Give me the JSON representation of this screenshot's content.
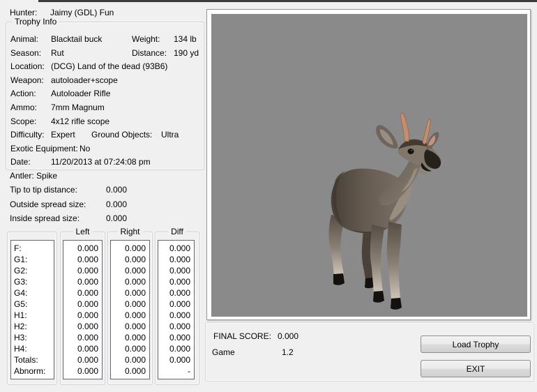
{
  "colors": {
    "window_bg": "#f0f0f0",
    "viewer_bg": "#8a8a8a",
    "top_edge": "#3b3b3b"
  },
  "hunter": {
    "label": "Hunter:",
    "value": "Jaimy (GDL) Fun"
  },
  "trophy_info": {
    "title": "Trophy Info",
    "rows": [
      {
        "label": "Animal:",
        "value": "Blacktail buck",
        "label2": "Weight:",
        "value2": "134 lb"
      },
      {
        "label": "Season:",
        "value": "Rut",
        "label2": "Distance:",
        "value2": "190 yd"
      },
      {
        "label": "Location:",
        "value": "(DCG) Land of the dead (93B6)"
      },
      {
        "label": "Weapon:",
        "value": "autoloader+scope"
      },
      {
        "label": "Action:",
        "value": "Autoloader Rifle"
      },
      {
        "label": "Ammo:",
        "value": "7mm Magnum"
      },
      {
        "label": "Scope:",
        "value": "4x12 rifle scope"
      },
      {
        "label": "Difficulty:",
        "value": "Expert",
        "label2": "Ground Objects:",
        "value2": "Ultra"
      },
      {
        "label": "Exotic Equipment:",
        "value": "No"
      },
      {
        "label": "Date:",
        "value": "11/20/2013 at 07:24:08 pm"
      }
    ]
  },
  "antler_section": {
    "rows": [
      {
        "label": "Antler: Spike",
        "value": ""
      },
      {
        "label": "Tip to tip distance:",
        "value": "0.000"
      },
      {
        "label": "Outside spread size:",
        "value": "0.000"
      },
      {
        "label": "Inside spread size:",
        "value": "0.000"
      }
    ]
  },
  "score_table": {
    "row_labels": [
      "F:",
      "G1:",
      "G2:",
      "G3:",
      "G4:",
      "G5:",
      "H1:",
      "H2:",
      "H3:",
      "H4:",
      "Totals:",
      "Abnorm:"
    ],
    "columns": [
      {
        "header": "Left",
        "values": [
          "0.000",
          "0.000",
          "0.000",
          "0.000",
          "0.000",
          "0.000",
          "0.000",
          "0.000",
          "0.000",
          "0.000",
          "0.000",
          "0.000"
        ]
      },
      {
        "header": "Right",
        "values": [
          "0.000",
          "0.000",
          "0.000",
          "0.000",
          "0.000",
          "0.000",
          "0.000",
          "0.000",
          "0.000",
          "0.000",
          "0.000",
          "0.000"
        ]
      },
      {
        "header": "Diff",
        "values": [
          "0.000",
          "0.000",
          "0.000",
          "0.000",
          "0.000",
          "0.000",
          "0.000",
          "0.000",
          "0.000",
          "0.000",
          "0.000",
          "-"
        ]
      }
    ]
  },
  "viewer": {
    "subject": "blacktail-buck-3d-render"
  },
  "summary": {
    "final_score_label": "FINAL SCORE:",
    "final_score_value": "0.000",
    "game_label": "Game",
    "game_value": "1.2"
  },
  "buttons": {
    "load_trophy": "Load Trophy",
    "exit": "EXIT"
  }
}
